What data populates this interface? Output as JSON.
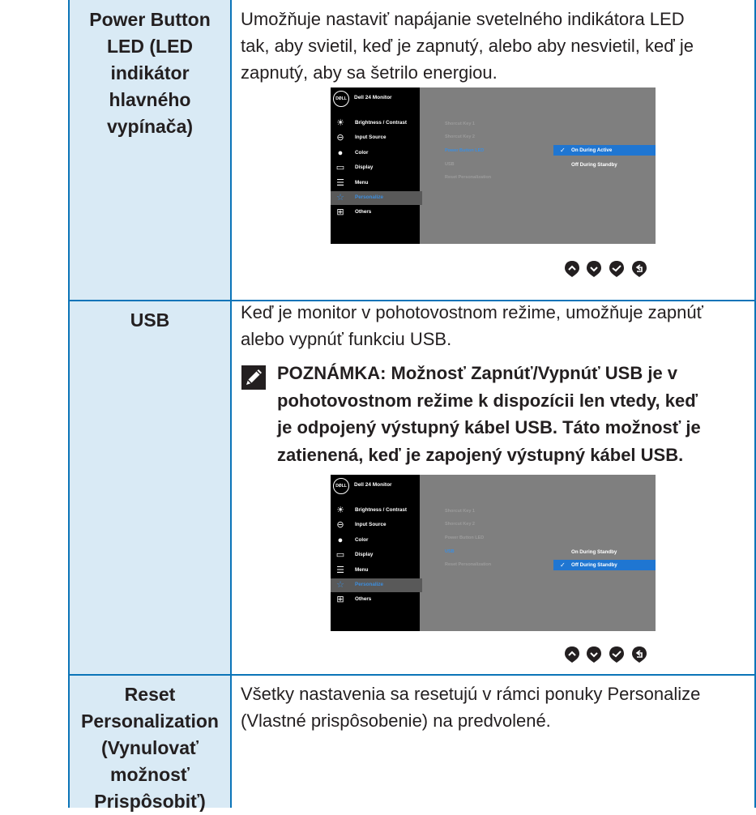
{
  "rows": [
    {
      "label_lines": [
        "Power Button",
        "LED (LED",
        "indikátor",
        "hlavného",
        "vypínača)"
      ],
      "desc": [
        "Umožňuje nastaviť napájanie svetelného indikátora LED",
        "tak, aby svietil, keď je zapnutý, alebo aby nesvietil, keď je",
        "zapnutý, aby sa šetrilo energiou."
      ]
    },
    {
      "label_lines": [
        "USB"
      ],
      "desc": [
        "Keď je monitor v pohotovostnom režime, umožňuje zapnúť",
        "alebo vypnúť funkciu USB."
      ],
      "note": [
        "POZNÁMKA: Možnosť Zapnúť/Vypnúť USB je v",
        "pohotovostnom režime k dispozícii len vtedy, keď",
        "je odpojený výstupný kábel USB. Táto možnosť je",
        "zatienená, keď je zapojený výstupný kábel USB."
      ]
    },
    {
      "label_lines": [
        "Reset",
        "Personalization",
        "(Vynulovať",
        "možnosť",
        "Prispôsobiť)"
      ],
      "desc": [
        "Všetky nastavenia sa resetujú v rámci ponuky Personalize",
        "(Vlastné prispôsobenie) na predvolené."
      ]
    }
  ],
  "osd": {
    "brand": "DØLL",
    "title": "Dell 24 Monitor",
    "menu": [
      {
        "icon": "brightness-icon",
        "label": "Brightness / Contrast"
      },
      {
        "icon": "input-source-icon",
        "label": "Input Source"
      },
      {
        "icon": "color-icon",
        "label": "Color"
      },
      {
        "icon": "display-icon",
        "label": "Display"
      },
      {
        "icon": "menu-icon",
        "label": "Menu"
      },
      {
        "icon": "personalize-icon",
        "label": "Personalize"
      },
      {
        "icon": "others-icon",
        "label": "Others"
      }
    ],
    "submenu": [
      "Shorcut Key 1",
      "Shorcut Key 2",
      "Power Button LED",
      "USB",
      "Reset Personalization"
    ],
    "osd1_options": [
      "On During Active",
      "Off During Standby"
    ],
    "osd2_options": [
      "On During Standby",
      "Off During Standby"
    ]
  },
  "colors": {
    "accent": "#0b74b8",
    "label_bg": "#d9eaf5",
    "osd_highlight": "#1f76d2",
    "osd_selected_text": "#3d8ede"
  }
}
